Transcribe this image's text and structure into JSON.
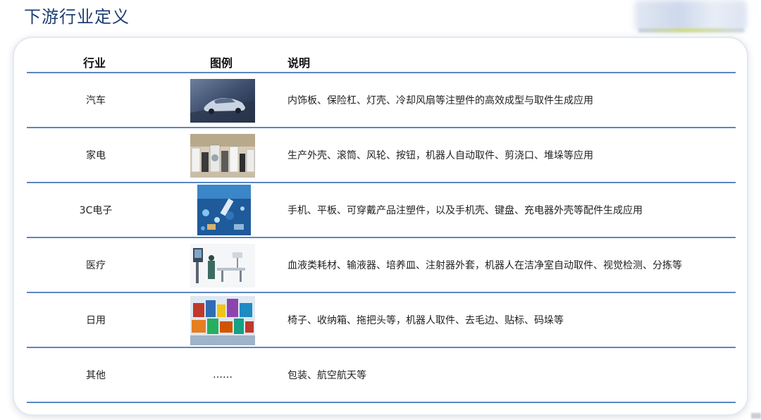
{
  "title": "下游行业定义",
  "header": {
    "industry": "行业",
    "figure": "图例",
    "description": "说明"
  },
  "rows": [
    {
      "industry": "汽车",
      "figure_icon": "car-image",
      "description": "内饰板、保险杠、灯壳、冷却风扇等注塑件的高效成型与取件生成应用"
    },
    {
      "industry": "家电",
      "figure_icon": "home-appliances-image",
      "description": "生产外壳、滚筒、风轮、按钮，机器人自动取件、剪浇口、堆垛等应用"
    },
    {
      "industry": "3C电子",
      "figure_icon": "electronics-components-image",
      "description": "手机、平板、可穿戴产品注塑件，以及手机壳、键盘、充电器外壳等配件生成应用"
    },
    {
      "industry": "医疗",
      "figure_icon": "medical-equipment-image",
      "description": "血液类耗材、输液器、培养皿、注射器外套，机器人在洁净室自动取件、视觉检测、分拣等"
    },
    {
      "industry": "日用",
      "figure_icon": "daily-goods-image",
      "description": "椅子、收纳箱、拖把头等，机器人取件、去毛边、贴标、码垛等"
    },
    {
      "industry": "其他",
      "figure_text": "……",
      "description": "包装、航空航天等"
    }
  ],
  "colors": {
    "title": "#1f3f73",
    "rule": "#5b86c2"
  }
}
